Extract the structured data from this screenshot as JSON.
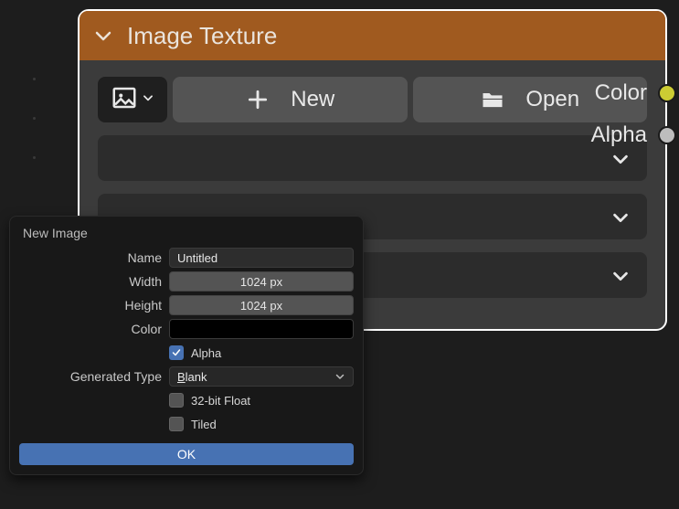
{
  "node": {
    "title": "Image Texture",
    "outputs": [
      {
        "label": "Color",
        "socket": "color"
      },
      {
        "label": "Alpha",
        "socket": "alpha"
      }
    ],
    "buttons": {
      "new": "New",
      "open": "Open"
    }
  },
  "popover": {
    "title": "New Image",
    "name_label": "Name",
    "name_value": "Untitled",
    "width_label": "Width",
    "width_value": "1024 px",
    "height_label": "Height",
    "height_value": "1024 px",
    "color_label": "Color",
    "color_value": "#000000",
    "alpha_label": "Alpha",
    "alpha_checked": true,
    "gentype_label": "Generated Type",
    "gentype_value": "Blank",
    "float_label": "32-bit Float",
    "float_checked": false,
    "tiled_label": "Tiled",
    "tiled_checked": false,
    "ok": "OK"
  }
}
